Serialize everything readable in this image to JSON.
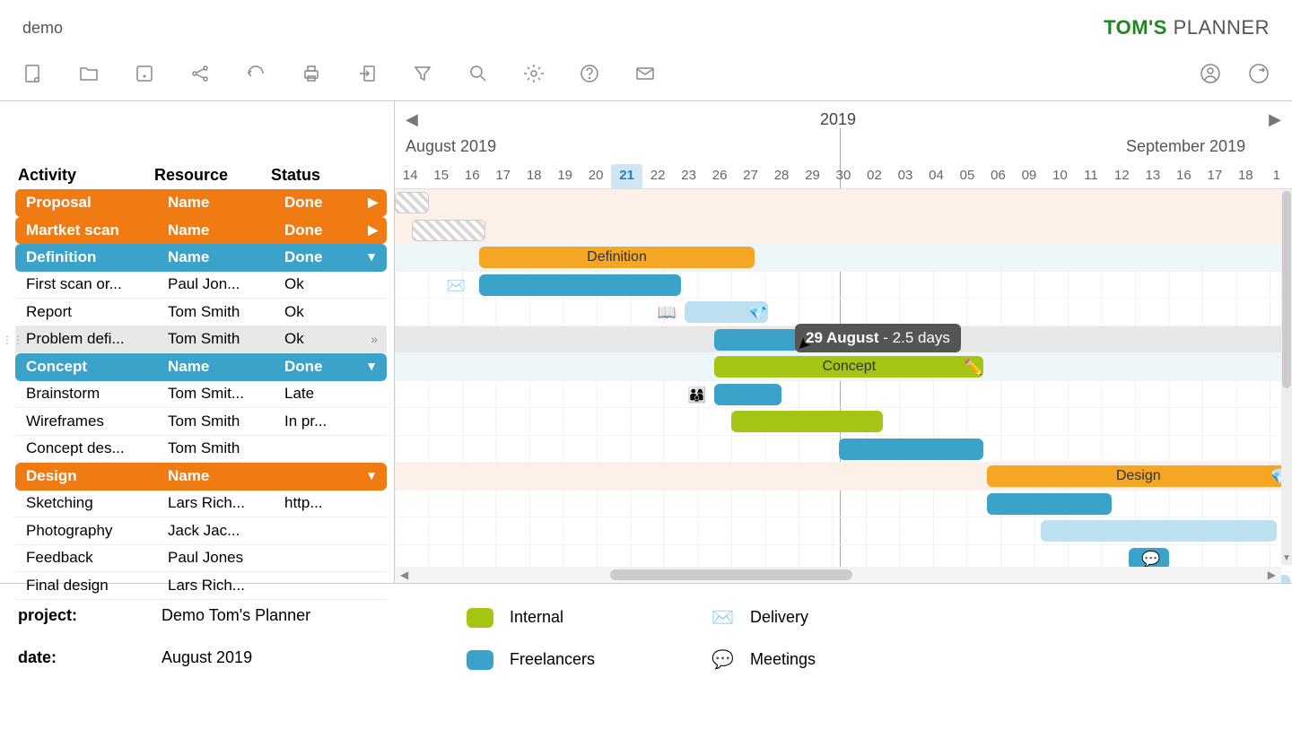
{
  "header": {
    "title": "demo",
    "logo_bold": "TOM'S",
    "logo_light": " PLANNER"
  },
  "columns": {
    "activity": "Activity",
    "resource": "Resource",
    "status": "Status"
  },
  "timeline": {
    "year": "2019",
    "months": {
      "aug": "August 2019",
      "sep": "September 2019"
    },
    "dates": [
      "14",
      "15",
      "16",
      "17",
      "18",
      "19",
      "20",
      "21",
      "22",
      "23",
      "26",
      "27",
      "28",
      "29",
      "30",
      "02",
      "03",
      "04",
      "05",
      "06",
      "09",
      "10",
      "11",
      "12",
      "13",
      "16",
      "17",
      "18",
      "1"
    ],
    "today_index": 7
  },
  "rows": [
    {
      "activity": "Proposal",
      "resource": "Name",
      "status": "Done",
      "type": "header",
      "color": "orange",
      "arrow": "▶",
      "tint": "orange"
    },
    {
      "activity": "Martket scan",
      "resource": "Name",
      "status": "Done",
      "type": "header",
      "color": "orange",
      "arrow": "▶",
      "tint": "orange"
    },
    {
      "activity": "Definition",
      "resource": "Name",
      "status": "Done",
      "type": "header",
      "color": "blue",
      "arrow": "▼",
      "tint": "blue"
    },
    {
      "activity": "First scan or...",
      "resource": "Paul Jon...",
      "status": "Ok",
      "type": "task"
    },
    {
      "activity": "Report",
      "resource": "Tom Smith",
      "status": "Ok",
      "type": "task"
    },
    {
      "activity": "Problem defi...",
      "resource": "Tom Smith",
      "status": "Ok",
      "type": "task",
      "highlight": true,
      "more": "»"
    },
    {
      "activity": "Concept",
      "resource": "Name",
      "status": "Done",
      "type": "header",
      "color": "blue",
      "arrow": "▼",
      "tint": "blue"
    },
    {
      "activity": "Brainstorm",
      "resource": "Tom Smit...",
      "status": "Late",
      "type": "task"
    },
    {
      "activity": "Wireframes",
      "resource": "Tom Smith",
      "status": "In pr...",
      "type": "task"
    },
    {
      "activity": "Concept des...",
      "resource": "Tom Smith",
      "status": "",
      "type": "task"
    },
    {
      "activity": "Design",
      "resource": "Name",
      "status": "",
      "type": "header",
      "color": "orange",
      "arrow": "▼",
      "tint": "orange"
    },
    {
      "activity": "Sketching",
      "resource": "Lars Rich...",
      "status": "http...",
      "type": "task"
    },
    {
      "activity": "Photography",
      "resource": "Jack Jac...",
      "status": "",
      "type": "task"
    },
    {
      "activity": "Feedback",
      "resource": "Paul Jones",
      "status": "",
      "type": "task"
    },
    {
      "activity": "Final design",
      "resource": "Lars Rich...",
      "status": "",
      "type": "task"
    }
  ],
  "chart_data": {
    "type": "gantt",
    "bars": [
      {
        "row": 0,
        "start": 0,
        "span": 1,
        "kind": "hatch"
      },
      {
        "row": 1,
        "start": 0.5,
        "span": 2.2,
        "kind": "hatch"
      },
      {
        "row": 2,
        "start": 2.5,
        "span": 8.2,
        "color": "orange",
        "label": "Definition"
      },
      {
        "row": 3,
        "start": 2.5,
        "span": 6,
        "color": "blue",
        "icon": "✉️",
        "icon_pos": 1.8
      },
      {
        "row": 4,
        "start": 8.6,
        "span": 2.5,
        "color": "lblue",
        "attach_left": "📖",
        "attach_right": "💎"
      },
      {
        "row": 5,
        "start": 9.5,
        "span": 2.5,
        "color": "blue",
        "tooltip": true
      },
      {
        "row": 6,
        "start": 9.5,
        "span": 8,
        "color": "green",
        "label": "Concept",
        "attach_right": "✏️"
      },
      {
        "row": 7,
        "start": 9.5,
        "span": 2,
        "color": "blue",
        "attach_left": "👨‍👩‍👦"
      },
      {
        "row": 8,
        "start": 10,
        "span": 4.5,
        "color": "green"
      },
      {
        "row": 9,
        "start": 13.2,
        "span": 4.3,
        "color": "blue"
      },
      {
        "row": 10,
        "start": 17.6,
        "span": 9,
        "color": "orange",
        "label": "Design",
        "attach_right": "💎"
      },
      {
        "row": 11,
        "start": 17.6,
        "span": 3.7,
        "color": "blue"
      },
      {
        "row": 12,
        "start": 19.2,
        "span": 7,
        "color": "lblue"
      },
      {
        "row": 13,
        "start": 21.8,
        "span": 1.2,
        "color": "blue",
        "attach_center": "💬"
      },
      {
        "row": 14,
        "start": 22.6,
        "span": 4,
        "color": "lblue"
      }
    ]
  },
  "tooltip": {
    "date": "29 August",
    "duration": "- 2.5 days"
  },
  "footer": {
    "project_lbl": "project:",
    "project_val": "Demo Tom's Planner",
    "date_lbl": "date:",
    "date_val": "August 2019"
  },
  "legend": {
    "internal": "Internal",
    "freelancers": "Freelancers",
    "delivery": "Delivery",
    "meetings": "Meetings"
  }
}
